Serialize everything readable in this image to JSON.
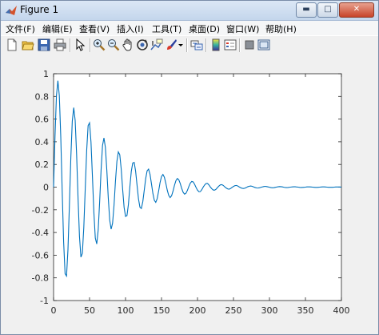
{
  "window": {
    "title": "Figure 1"
  },
  "window_buttons": {
    "minimize": "▬",
    "maximize": "□",
    "close": "✕"
  },
  "menu": [
    {
      "label": "文件(F)"
    },
    {
      "label": "编辑(E)"
    },
    {
      "label": "查看(V)"
    },
    {
      "label": "插入(I)"
    },
    {
      "label": "工具(T)"
    },
    {
      "label": "桌面(D)"
    },
    {
      "label": "窗口(W)"
    },
    {
      "label": "帮助(H)"
    }
  ],
  "toolbar": {
    "icons": [
      "new-figure-icon",
      "open-file-icon",
      "save-icon",
      "print-icon",
      "pointer-icon",
      "zoom-in-icon",
      "zoom-out-icon",
      "pan-hand-icon",
      "rotate-3d-icon",
      "data-cursor-icon",
      "brush-icon",
      "brush-dropdown-icon",
      "link-plot-icon",
      "insert-colorbar-icon",
      "insert-legend-icon",
      "hide-plot-tools-icon",
      "show-plot-tools-icon"
    ]
  },
  "chart_data": {
    "type": "line",
    "title": "",
    "xlabel": "",
    "ylabel": "",
    "xlim": [
      0,
      400
    ],
    "ylim": [
      -1,
      1
    ],
    "xticks": [
      0,
      50,
      100,
      150,
      200,
      250,
      300,
      350,
      400
    ],
    "yticks": [
      -1,
      -0.8,
      -0.6,
      -0.4,
      -0.2,
      0,
      0.2,
      0.4,
      0.6,
      0.8,
      1
    ],
    "xtick_labels": [
      "0",
      "50",
      "100",
      "150",
      "200",
      "250",
      "300",
      "350",
      "400"
    ],
    "ytick_labels": [
      "-1",
      "-0.8",
      "-0.6",
      "-0.4",
      "-0.2",
      "0",
      "0.2",
      "0.4",
      "0.6",
      "0.8",
      "1"
    ],
    "grid": false,
    "line_color": "#0072bd",
    "series": [
      {
        "description_formula": "damped sine",
        "x": [
          0,
          2,
          4,
          6,
          8,
          10,
          12,
          14,
          16,
          18,
          20,
          22,
          24,
          26,
          28,
          30,
          32,
          34,
          36,
          38,
          40,
          42,
          44,
          46,
          48,
          50,
          52,
          54,
          56,
          58,
          60,
          62,
          64,
          66,
          68,
          70,
          72,
          74,
          76,
          78,
          80,
          82,
          84,
          86,
          88,
          90,
          92,
          94,
          96,
          98,
          100,
          102,
          104,
          106,
          108,
          110,
          112,
          114,
          116,
          118,
          120,
          122,
          124,
          126,
          128,
          130,
          132,
          134,
          136,
          138,
          140,
          142,
          144,
          146,
          148,
          150,
          152,
          154,
          156,
          158,
          160,
          162,
          164,
          166,
          168,
          170,
          172,
          174,
          176,
          178,
          180,
          182,
          184,
          186,
          188,
          190,
          192,
          194,
          196,
          198,
          200,
          202,
          204,
          206,
          208,
          210,
          212,
          214,
          216,
          218,
          220,
          222,
          224,
          226,
          228,
          230,
          232,
          234,
          236,
          238,
          240,
          242,
          244,
          246,
          248,
          250,
          252,
          254,
          256,
          258,
          260,
          262,
          264,
          266,
          268,
          270,
          272,
          274,
          276,
          278,
          280,
          282,
          284,
          286,
          288,
          290,
          292,
          294,
          296,
          298,
          300,
          302,
          304,
          306,
          308,
          310,
          312,
          314,
          316,
          318,
          320,
          322,
          324,
          326,
          328,
          330,
          332,
          334,
          336,
          338,
          340,
          342,
          344,
          346,
          348,
          350,
          352,
          354,
          356,
          358,
          360,
          362,
          364,
          366,
          368,
          370,
          372,
          374,
          376,
          378,
          380,
          382,
          384,
          386,
          388,
          390,
          392,
          394,
          396,
          398,
          400
        ],
        "y": [
          0,
          0.449,
          0.807,
          0.939,
          0.805,
          0.443,
          -0.039,
          -0.486,
          -0.763,
          -0.784,
          -0.55,
          -0.159,
          0.262,
          0.582,
          0.701,
          0.589,
          0.291,
          -0.095,
          -0.435,
          -0.617,
          -0.584,
          -0.356,
          -0.016,
          0.322,
          0.542,
          0.567,
          0.397,
          0.094,
          -0.222,
          -0.449,
          -0.501,
          -0.378,
          -0.133,
          0.148,
          0.366,
          0.434,
          0.35,
          0.15,
          -0.093,
          -0.29,
          -0.37,
          -0.318,
          -0.16,
          0.052,
          0.227,
          0.311,
          0.286,
          0.159,
          -0.019,
          -0.178,
          -0.258,
          -0.251,
          -0.152,
          0.002,
          0.138,
          0.213,
          0.218,
          0.141,
          0.017,
          -0.104,
          -0.177,
          -0.188,
          -0.128,
          -0.028,
          0.075,
          0.144,
          0.159,
          0.114,
          0.031,
          -0.055,
          -0.116,
          -0.134,
          -0.101,
          -0.034,
          0.041,
          0.094,
          0.112,
          0.087,
          0.034,
          -0.027,
          -0.073,
          -0.092,
          -0.076,
          -0.035,
          0.016,
          0.057,
          0.076,
          0.065,
          0.032,
          -0.01,
          -0.045,
          -0.062,
          -0.054,
          -0.028,
          0.006,
          0.035,
          0.05,
          0.046,
          0.025,
          -0.003,
          -0.027,
          -0.04,
          -0.039,
          -0.022,
          0.001,
          0.02,
          0.032,
          0.032,
          0.019,
          0.0,
          -0.015,
          -0.026,
          -0.026,
          -0.017,
          -0.002,
          0.011,
          0.021,
          0.022,
          0.014,
          0.002,
          -0.008,
          -0.016,
          -0.018,
          -0.012,
          -0.002,
          0.006,
          0.013,
          0.015,
          0.01,
          0.002,
          -0.005,
          -0.01,
          -0.012,
          -0.009,
          -0.003,
          0.004,
          0.008,
          0.01,
          0.007,
          0.002,
          -0.003,
          -0.007,
          -0.008,
          -0.006,
          -0.002,
          0.002,
          0.005,
          0.007,
          0.005,
          0.002,
          -0.001,
          -0.004,
          -0.006,
          -0.005,
          -0.002,
          0.001,
          0.003,
          0.005,
          0.004,
          0.002,
          -0.001,
          -0.003,
          -0.004,
          -0.003,
          -0.001,
          0.001,
          0.002,
          0.003,
          0.003,
          0.001,
          -0.0,
          -0.002,
          -0.003,
          -0.002,
          -0.001,
          0.0,
          0.002,
          0.002,
          0.002,
          0.001,
          -0.0,
          -0.001,
          -0.002,
          -0.002,
          -0.001,
          0.0,
          0.001,
          0.002,
          0.002,
          0.001,
          0.0,
          -0.001,
          -0.001,
          -0.001,
          -0.001,
          0.0,
          0.001,
          0.001,
          0.001,
          0.001,
          0.0
        ]
      }
    ]
  }
}
